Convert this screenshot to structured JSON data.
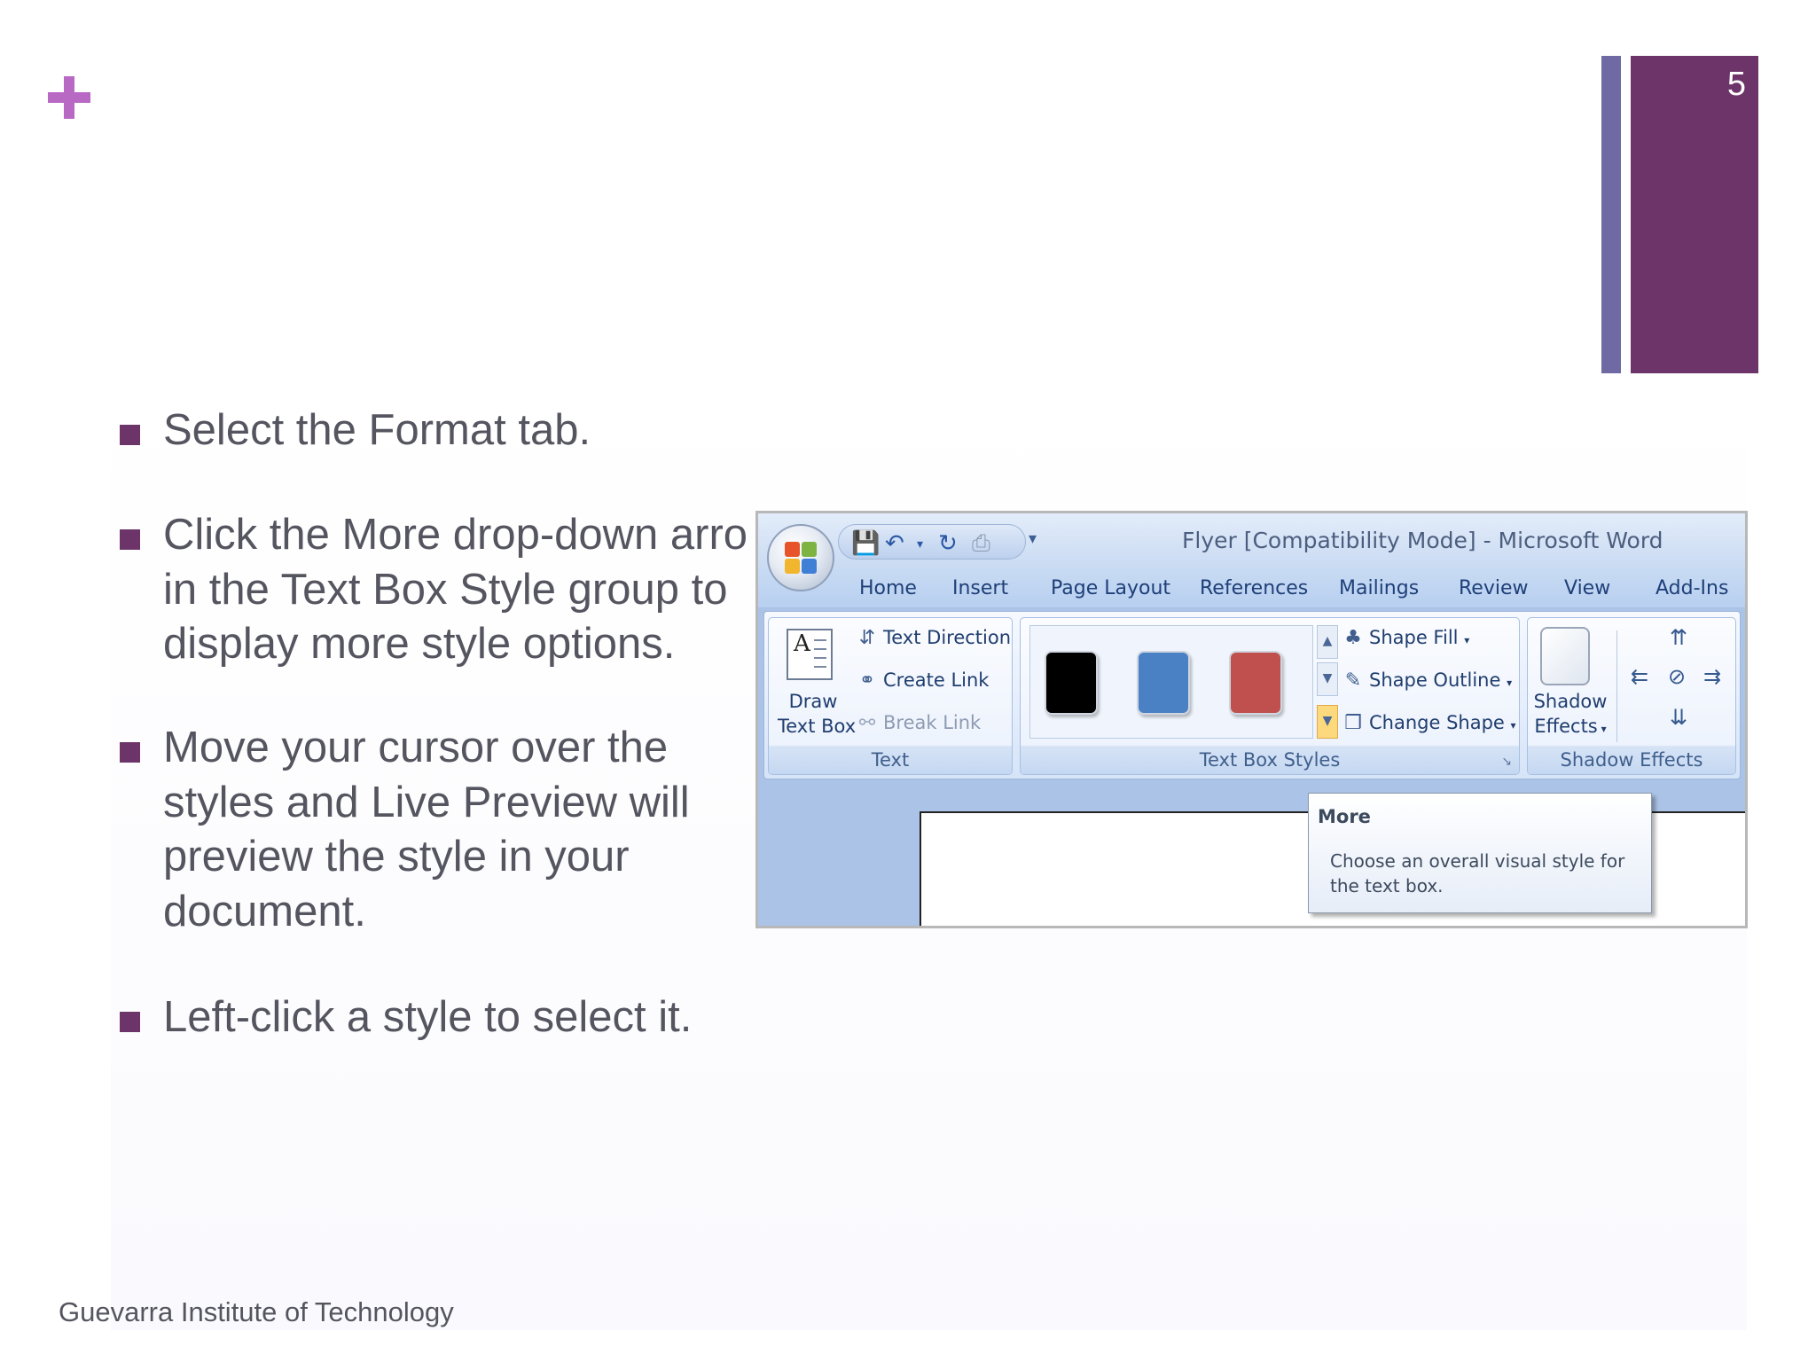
{
  "slide": {
    "number": "5",
    "footer": "Guevarra Institute of Technology"
  },
  "bullets": [
    {
      "lines": [
        "Select the Format tab."
      ]
    },
    {
      "lines": [
        "Click the More drop-down arro",
        "in the Text Box Style group to",
        "display more style options."
      ]
    },
    {
      "lines": [
        "Move your cursor over the",
        "styles and Live Preview will",
        "preview the style in your",
        "document."
      ]
    },
    {
      "lines": [
        "Left-click a style to select it."
      ]
    }
  ],
  "word": {
    "title": "Flyer [Compatibility Mode] - Microsoft Word",
    "tabs": [
      "Home",
      "Insert",
      "Page Layout",
      "References",
      "Mailings",
      "Review",
      "View",
      "Add-Ins"
    ],
    "groups": {
      "text": {
        "label": "Text",
        "draw_text_box": [
          "Draw",
          "Text Box"
        ],
        "text_direction": "Text Direction",
        "create_link": "Create Link",
        "break_link": "Break Link"
      },
      "text_box_styles": {
        "label": "Text Box Styles",
        "swatch_colors": [
          "#000000",
          "#4a80c4",
          "#c0504d"
        ],
        "shape_fill": "Shape Fill",
        "shape_outline": "Shape Outline",
        "change_shape": "Change Shape"
      },
      "shadow_effects": {
        "label": "Shadow Effects",
        "button": [
          "Shadow",
          "Effects"
        ]
      }
    },
    "tooltip": {
      "title": "More",
      "body": "Choose an overall visual style for the text box."
    }
  },
  "colors": {
    "accent_purple": "#6c3468",
    "accent_lavender": "#6f6aa3",
    "plus_pink": "#b869c4"
  }
}
